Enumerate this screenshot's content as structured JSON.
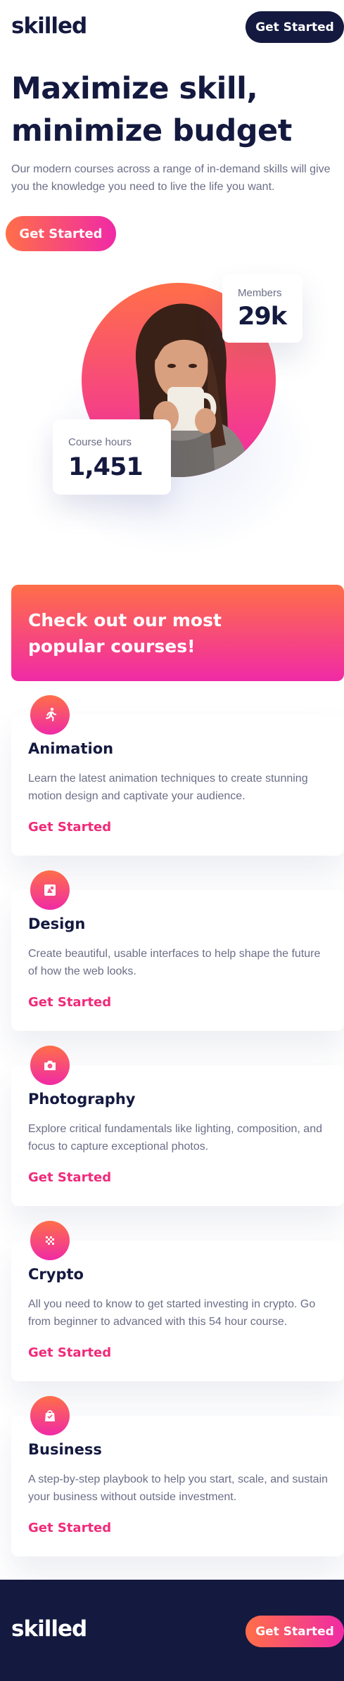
{
  "header": {
    "logo": "skilled",
    "cta_label": "Get Started"
  },
  "hero": {
    "title": "Maximize skill, minimize budget",
    "text": "Our modern courses across a range of in-demand skills will give you the knowledge you need to live the life you want.",
    "cta_label": "Get Started",
    "stats": {
      "members_label": "Members",
      "members_value": "29k",
      "hours_label": "Course hours",
      "hours_value": "1,451"
    }
  },
  "popular": {
    "title": "Check out our most popular courses!"
  },
  "courses": [
    {
      "icon": "animation-icon",
      "title": "Animation",
      "description": "Learn the latest animation techniques to create stunning motion design and captivate your audience.",
      "link": "Get Started"
    },
    {
      "icon": "design-icon",
      "title": "Design",
      "description": "Create beautiful, usable interfaces to help shape the future of how the web looks.",
      "link": "Get Started"
    },
    {
      "icon": "camera-icon",
      "title": "Photography",
      "description": "Explore critical fundamentals like lighting, composition, and focus to capture exceptional photos.",
      "link": "Get Started"
    },
    {
      "icon": "crypto-icon",
      "title": "Crypto",
      "description": "All you need to know to get started investing in crypto. Go from beginner to advanced with this 54 hour course.",
      "link": "Get Started"
    },
    {
      "icon": "business-icon",
      "title": "Business",
      "description": "A step-by-step playbook to help you start, scale, and sustain your business without outside investment.",
      "link": "Get Started"
    }
  ],
  "footer": {
    "logo": "skilled",
    "cta_label": "Get Started"
  },
  "colors": {
    "navy": "#14193f",
    "text_muted": "#6b6e87",
    "gradient_start": "#ff6f48",
    "gradient_end": "#f02aa6",
    "link": "#f02a79"
  }
}
